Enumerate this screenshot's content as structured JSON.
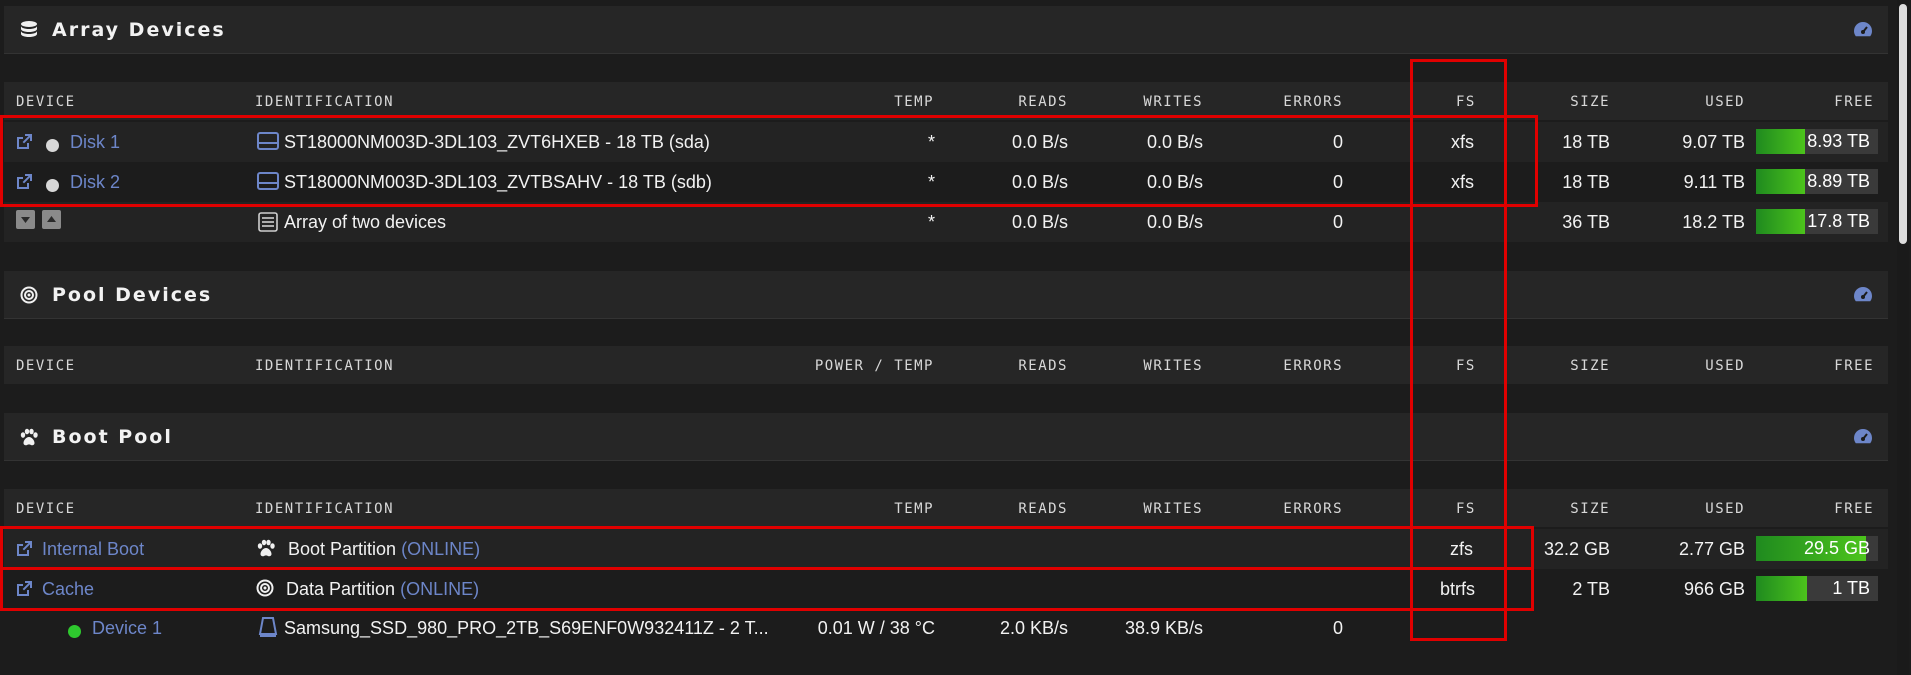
{
  "array": {
    "title": "Array Devices",
    "icon": "database-icon",
    "dashboard_icon": "dashboard-icon",
    "columns": {
      "device": "DEVICE",
      "identification": "IDENTIFICATION",
      "temp": "TEMP",
      "reads": "READS",
      "writes": "WRITES",
      "errors": "ERRORS",
      "fs": "FS",
      "size": "SIZE",
      "used": "USED",
      "free": "FREE"
    },
    "rows": [
      {
        "name": "Disk 1",
        "identification": "ST18000NM003D-3DL103_ZVT6HXEB - 18 TB (sda)",
        "temp": "*",
        "reads": "0.0 B/s",
        "writes": "0.0 B/s",
        "errors": "0",
        "fs": "xfs",
        "size": "18 TB",
        "used": "9.07 TB",
        "free": "8.93 TB",
        "free_fraction": 0.4
      },
      {
        "name": "Disk 2",
        "identification": "ST18000NM003D-3DL103_ZVTBSAHV - 18 TB (sdb)",
        "temp": "*",
        "reads": "0.0 B/s",
        "writes": "0.0 B/s",
        "errors": "0",
        "fs": "xfs",
        "size": "18 TB",
        "used": "9.11 TB",
        "free": "8.89 TB",
        "free_fraction": 0.4
      }
    ],
    "summary": {
      "identification": "Array of two devices",
      "temp": "*",
      "reads": "0.0 B/s",
      "writes": "0.0 B/s",
      "errors": "0",
      "size": "36 TB",
      "used": "18.2 TB",
      "free": "17.8 TB",
      "free_fraction": 0.4
    }
  },
  "pool": {
    "title": "Pool Devices",
    "icon": "target-icon",
    "columns": {
      "device": "DEVICE",
      "identification": "IDENTIFICATION",
      "temp": "POWER / TEMP",
      "reads": "READS",
      "writes": "WRITES",
      "errors": "ERRORS",
      "fs": "FS",
      "size": "SIZE",
      "used": "USED",
      "free": "FREE"
    }
  },
  "boot": {
    "title": "Boot Pool",
    "icon": "paw-icon",
    "columns": {
      "device": "DEVICE",
      "identification": "IDENTIFICATION",
      "temp": "TEMP",
      "reads": "READS",
      "writes": "WRITES",
      "errors": "ERRORS",
      "fs": "FS",
      "size": "SIZE",
      "used": "USED",
      "free": "FREE"
    },
    "rows": [
      {
        "name": "Internal Boot",
        "identification": "Boot Partition",
        "status": "(ONLINE)",
        "fs": "zfs",
        "size": "32.2 GB",
        "used": "2.77 GB",
        "free": "29.5 GB",
        "free_fraction": 0.9
      },
      {
        "name": "Cache",
        "identification": "Data Partition",
        "status": "(ONLINE)",
        "fs": "btrfs",
        "size": "2 TB",
        "used": "966 GB",
        "free": "1 TB",
        "free_fraction": 0.42
      }
    ],
    "subdevice": {
      "name": "Device 1",
      "identification": "Samsung_SSD_980_PRO_2TB_S69ENF0W932411Z - 2 T...",
      "temp": "0.01 W / 38 °C",
      "reads": "2.0 KB/s",
      "writes": "38.9 KB/s",
      "errors": "0"
    }
  },
  "colors": {
    "accent": "#6d86c9",
    "highlight": "#e00000",
    "bar_green": "#3cb01c",
    "status_online": "#2ec82e"
  }
}
